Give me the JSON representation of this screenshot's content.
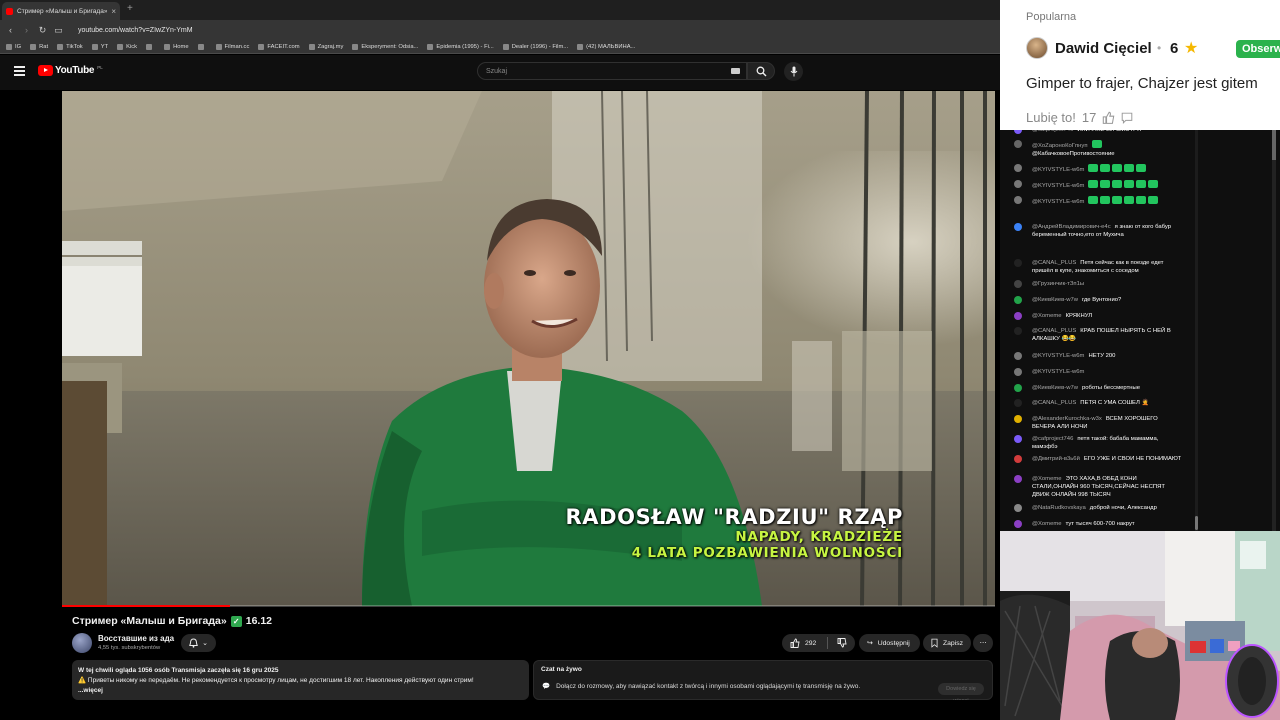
{
  "browser": {
    "tab_title": "Стример «Малыш и Бригада» ✅ 16.12",
    "tab_close": "×",
    "new_tab": "+",
    "url": "youtube.com/watch?v=ZIwZYn-YmM",
    "bookmarks": [
      "IG",
      "Rat",
      "TikTok",
      "YT",
      "Kick",
      "",
      "Home",
      "",
      "Filman.cc",
      "FACEIT.com",
      "Zagraj.my",
      "Eksperyment: Odsia...",
      "Epidemia (1995) - Fi...",
      "Dealer (1996) - Film...",
      "(42) МАЛЬВИНА..."
    ]
  },
  "youtube": {
    "logo_text": "YouTube",
    "logo_region": "PL",
    "search_placeholder": "Szukaj"
  },
  "video": {
    "overlay_name": "RADOSŁAW \"RADZIU\" RZĄP",
    "overlay_line1": "NAPADY, KRADZIEŻE",
    "overlay_line2": "4 LATA POZBAWIENIA WOLNOŚCI",
    "progress_fraction": 0.18
  },
  "watch": {
    "title": "Стример «Малыш и Бригада»",
    "title_suffix": "16.12",
    "channel_name": "Восставшие из ада",
    "channel_subs": "4,55 tys. subskrybentów",
    "like_count": "292",
    "share_label": "Udostępnij",
    "save_label": "Zapisz",
    "desc_line1": "W tej chwili ogląda 1056 osób  Transmisja zaczęła się 16 gru 2025",
    "desc_line2": "Приветы никому не передаём. Не рекомендуется к просмотру лицам, не достигшим 18 лет. Накопления действуют один стрим!",
    "desc_more": "...więcej",
    "chat_title": "Czat na żywo",
    "chat_message": "Dołącz do rozmowy, aby nawiązać kontakt z twórcą i innymi osobami oglądającymi tę transmisję na żywo.",
    "chat_button": "Dowiedz się więcej"
  },
  "comment": {
    "label": "Popularna",
    "user": "Dawid Cięciel",
    "dot": "•",
    "score": "6",
    "star": "★",
    "follow": "Obserwuj",
    "text": "Gimper to frajer, Chajzer jest gitem",
    "like_label": "Lubię to!",
    "like_count": "17"
  },
  "livechat": [
    {
      "author": "@cafproject746",
      "text": "ИЛИ УЖЕ ЕЙ СМОТРЯ",
      "color": "#7a5af8",
      "emotes": 0
    },
    {
      "author": "@ХоZароноКоГпнуп",
      "text": "@КабачковоеПротивостояние",
      "color": "#666",
      "emotes": 1
    },
    {
      "author": "@KYIVSTYLE-w6m",
      "text": "",
      "color": "#777",
      "emotes": 5
    },
    {
      "author": "@KYIVSTYLE-w6m",
      "text": "",
      "color": "#777",
      "emotes": 6
    },
    {
      "author": "@KYIVSTYLE-w6m",
      "text": "",
      "color": "#777",
      "emotes": 6
    },
    {
      "author": "@АндрейВладимирович-е4с",
      "text": "я знаю от кого бабур беременный точно,ето от Мухича",
      "color": "#3b82f6",
      "emotes": 0
    },
    {
      "author": "@CANAL_PLUS",
      "text": "Петя сейчас как в поезде едет пришёл в купе, знакомиться с соседом",
      "color": "#222",
      "emotes": 0
    },
    {
      "author": "@Грузинчик-тЗп1ы",
      "text": "",
      "color": "#444",
      "emotes": 0
    },
    {
      "author": "@КиевКиев-w7w",
      "text": "где Вунтонио?",
      "color": "#22a34a",
      "emotes": 0
    },
    {
      "author": "@Xomeme",
      "text": "КРЯКНУЛ",
      "color": "#8b3fc4",
      "emotes": 0
    },
    {
      "author": "@CANAL_PLUS",
      "text": "КРАБ ПОШЕЛ НЫРЯТЬ С НЕЙ В АЛКАШКУ 😂😂",
      "color": "#222",
      "emotes": 0
    },
    {
      "author": "@KYIVSTYLE-w6m",
      "text": "НЕТУ 200",
      "color": "#777",
      "emotes": 0
    },
    {
      "author": "@KYIVSTYLE-w6m",
      "text": "",
      "color": "#777",
      "emotes": 0
    },
    {
      "author": "@КиевКиев-w7w",
      "text": "роботы бессмертные",
      "color": "#22a34a",
      "emotes": 0
    },
    {
      "author": "@CANAL_PLUS",
      "text": "ПЕТЯ С УМА СОШЕЛ 🤦",
      "color": "#222",
      "emotes": 0
    },
    {
      "author": "@AlexanderKurochka-w3x",
      "text": "ВСЕМ ХОРОШЕГО ВЕЧЕРА АЛИ НОЧИ",
      "color": "#e0b000",
      "emotes": 0
    },
    {
      "author": "@cafproject746",
      "text": "петя такой: бабаба мамамма, мамэфбэ",
      "color": "#7a5af8",
      "emotes": 0
    },
    {
      "author": "@Дмитрий-в3ь6й",
      "text": "ЕГО УЖЕ И СВОИ НЕ ПОНИМАЮТ",
      "color": "#d23c3c",
      "emotes": 0
    },
    {
      "author": "@Xomeme",
      "text": "ЭТО ХАХА,В ОБЕД КОНИ СТАЛИ,ОНЛАЙН 960 ТЫСЯЧ,СЕЙЧАС НЕСПЯТ ДВИЖ ОНЛАЙН 998 ТЫСЯЧ",
      "color": "#8b3fc4",
      "emotes": 0
    },
    {
      "author": "@NataRudkovskaya",
      "text": "доброй ночи, Александр",
      "color": "#888",
      "emotes": 0
    },
    {
      "author": "@Xomeme",
      "text": "тут тысяч 600-700 накрут",
      "color": "#8b3fc4",
      "emotes": 0
    }
  ]
}
